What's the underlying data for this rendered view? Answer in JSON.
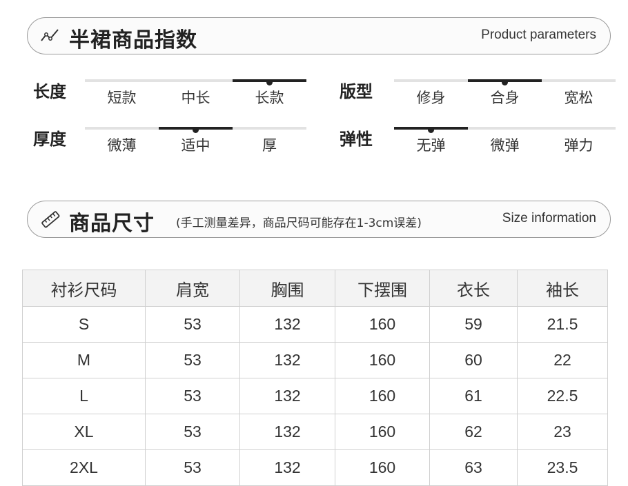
{
  "params_section": {
    "title": "半裙商品指数",
    "english": "Product parameters",
    "icon": "trend-line-icon"
  },
  "params": {
    "length": {
      "label": "长度",
      "options": [
        "短款",
        "中长",
        "长款"
      ],
      "selected": 2
    },
    "fit": {
      "label": "版型",
      "options": [
        "修身",
        "合身",
        "宽松"
      ],
      "selected": 1
    },
    "thickness": {
      "label": "厚度",
      "options": [
        "微薄",
        "适中",
        "厚"
      ],
      "selected": 1
    },
    "elasticity": {
      "label": "弹性",
      "options": [
        "无弹",
        "微弹",
        "弹力"
      ],
      "selected": 0
    }
  },
  "size_section": {
    "title": "商品尺寸",
    "note": "(手工测量差异，商品尺码可能存在1-3cm误差)",
    "english": "Size information",
    "icon": "ruler-icon"
  },
  "size_table": {
    "headers": [
      "衬衫尺码",
      "肩宽",
      "胸围",
      "下摆围",
      "衣长",
      "袖长"
    ],
    "rows": [
      [
        "S",
        "53",
        "132",
        "160",
        "59",
        "21.5"
      ],
      [
        "M",
        "53",
        "132",
        "160",
        "60",
        "22"
      ],
      [
        "L",
        "53",
        "132",
        "160",
        "61",
        "22.5"
      ],
      [
        "XL",
        "53",
        "132",
        "160",
        "62",
        "23"
      ],
      [
        "2XL",
        "53",
        "132",
        "160",
        "63",
        "23.5"
      ]
    ]
  },
  "colors": {
    "marker": "#222222",
    "track": "#e2e2e2",
    "border": "#9a9a9a",
    "header_bg": "#f3f3f3"
  }
}
